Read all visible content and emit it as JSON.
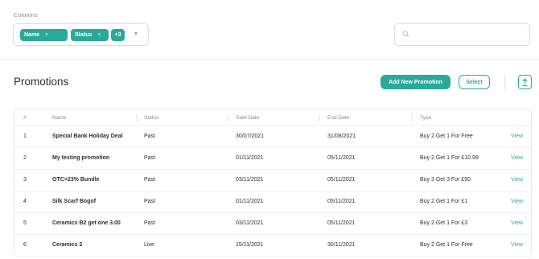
{
  "filters": {
    "columns_label": "Columns",
    "chips": [
      {
        "label": "Name",
        "remove": "×"
      },
      {
        "label": "Status",
        "remove": "×"
      }
    ],
    "more_count": "+3",
    "caret": "▾",
    "search_placeholder": ""
  },
  "header": {
    "title": "Promotions",
    "add_button": "Add New Promotion",
    "select_button": "Select"
  },
  "table": {
    "columns": [
      "#",
      "Name",
      "Status",
      "Start Date",
      "End Date",
      "Type"
    ],
    "rows": [
      {
        "num": "1",
        "name": "Special Bank Holiday Deal",
        "status": "Past",
        "start": "30/07/2021",
        "end": "31/08/2021",
        "type": "Buy 2 Get 1 For Free",
        "action": "View"
      },
      {
        "num": "2",
        "name": "My testing promotion",
        "status": "Past",
        "start": "01/11/2021",
        "end": "05/11/2021",
        "type": "Buy 2 Get 1 For £10.99",
        "action": "View"
      },
      {
        "num": "3",
        "name": "OTC>23% Bundle",
        "status": "Past",
        "start": "03/11/2021",
        "end": "05/11/2021",
        "type": "Buy 3 Get 3 For £50",
        "action": "View"
      },
      {
        "num": "4",
        "name": "Silk Scarf Bogof",
        "status": "Past",
        "start": "01/11/2021",
        "end": "05/11/2021",
        "type": "Buy 2 Get 1 For £1",
        "action": "View"
      },
      {
        "num": "5",
        "name": "Ceramics B2 get one 3.00",
        "status": "Past",
        "start": "03/11/2021",
        "end": "05/11/2021",
        "type": "Buy 2 Get 1 For £3",
        "action": "View"
      },
      {
        "num": "6",
        "name": "Ceramics 2",
        "status": "Live",
        "start": "15/11/2021",
        "end": "30/11/2021",
        "type": "Buy 2 Get 1 For Free",
        "action": "View"
      }
    ]
  },
  "icons": {
    "search": "search-icon",
    "export": "upload-icon"
  },
  "colors": {
    "accent": "#2aa89a",
    "border": "#d9dde0"
  }
}
